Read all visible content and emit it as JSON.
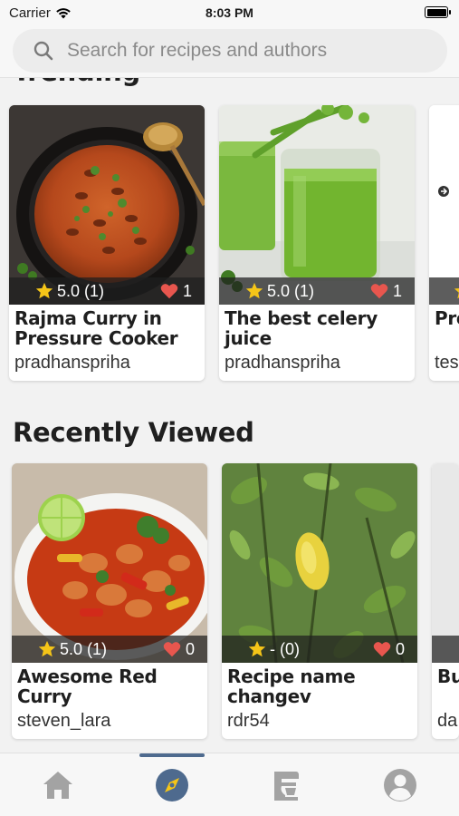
{
  "status_bar": {
    "carrier": "Carrier",
    "time": "8:03 PM"
  },
  "search": {
    "placeholder": "Search for recipes and authors"
  },
  "sections": {
    "trending": {
      "title": "Trending",
      "cards": [
        {
          "title": "Rajma Curry in Pressure Cooker",
          "author": "pradhanspriha",
          "rating": "5.0 (1)",
          "likes": "1",
          "image": "curry-bowl-photo"
        },
        {
          "title": "The best celery juice",
          "author": "pradhanspriha",
          "rating": "5.0 (1)",
          "likes": "1",
          "image": "green-juice-photo"
        },
        {
          "title": "Pro",
          "author": "tes",
          "rating": "",
          "likes": "",
          "image": "partial-photo"
        }
      ]
    },
    "recently_viewed": {
      "title": "Recently Viewed",
      "cards": [
        {
          "title": "Awesome Red Curry",
          "author": "steven_lara",
          "rating": "5.0 (1)",
          "likes": "0",
          "image": "chicken-curry-photo"
        },
        {
          "title": "Recipe name changev",
          "author": "rdr54",
          "rating": "- (0)",
          "likes": "0",
          "image": "lemon-tree-photo"
        },
        {
          "title": "Bu Sa",
          "author": "da",
          "rating": "",
          "likes": "",
          "image": "partial-photo"
        }
      ]
    }
  },
  "tab_bar": {
    "tabs": [
      {
        "name": "home",
        "icon": "home-icon",
        "active": false
      },
      {
        "name": "explore",
        "icon": "compass-icon",
        "active": true
      },
      {
        "name": "kitchen",
        "icon": "mixer-icon",
        "active": false
      },
      {
        "name": "profile",
        "icon": "user-icon",
        "active": false
      }
    ]
  },
  "colors": {
    "accent": "#4e6a8e",
    "heart": "#e8564e",
    "star": "#f5c518",
    "tab_inactive": "#a3a3a3"
  }
}
